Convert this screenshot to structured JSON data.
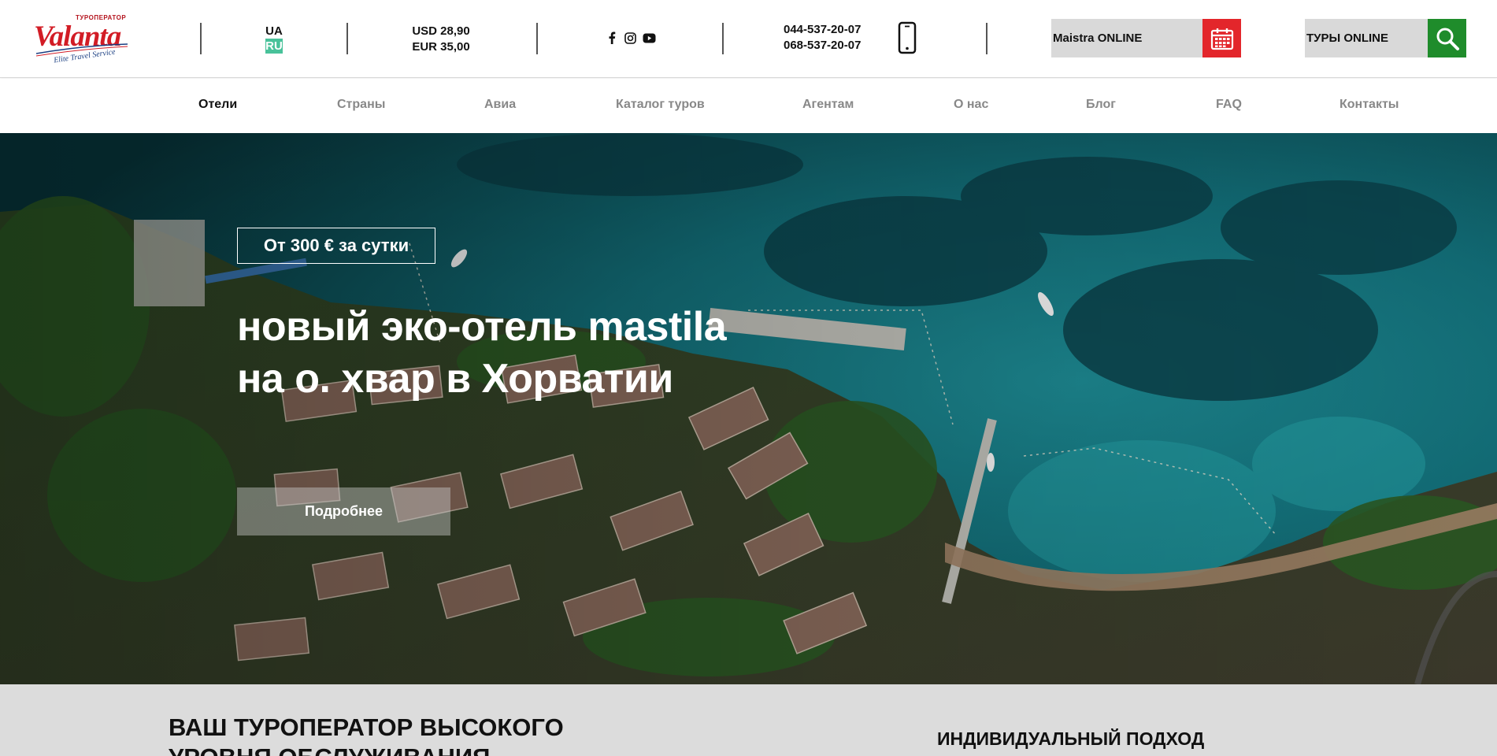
{
  "logo": {
    "top_text": "ТУРОПЕРАТОР",
    "brand": "Valanta",
    "tagline": "Elite Travel Service"
  },
  "languages": {
    "ua": "UA",
    "ru": "RU",
    "active": "RU"
  },
  "rates": {
    "usd": "USD 28,90",
    "eur": "EUR 35,00"
  },
  "social": [
    "facebook-icon",
    "instagram-icon",
    "youtube-icon"
  ],
  "phones": {
    "phone1": "044-537-20-07",
    "phone2": "068-537-20-07"
  },
  "buttons": {
    "maistra": "Maistra ONLINE",
    "tours": "ТУРЫ ONLINE"
  },
  "nav": [
    {
      "label": "Отели",
      "active": true
    },
    {
      "label": "Страны"
    },
    {
      "label": "Авиа"
    },
    {
      "label": "Каталог туров"
    },
    {
      "label": "Агентам"
    },
    {
      "label": "О нас"
    },
    {
      "label": "Блог"
    },
    {
      "label": "FAQ"
    },
    {
      "label": "Контакты"
    }
  ],
  "hero": {
    "price": "От 300 € за сутки",
    "title_line1": "новый эко-отель mastila",
    "title_line2": "на о. хвар в Хорватии",
    "button": "Подробнее"
  },
  "bottom": {
    "title_line1": "ВАШ ТУРОПЕРАТОР ВЫСОКОГО",
    "title_line2": "УРОВНЯ ОБСЛУЖИВАНИЯ",
    "subtitle": "ИНДИВИДУАЛЬНЫЙ ПОДХОД"
  },
  "colors": {
    "brand_red": "#d21c25",
    "calendar_red": "#e3262b",
    "search_green": "#1f8c2b",
    "lang_active": "#49c29a"
  }
}
